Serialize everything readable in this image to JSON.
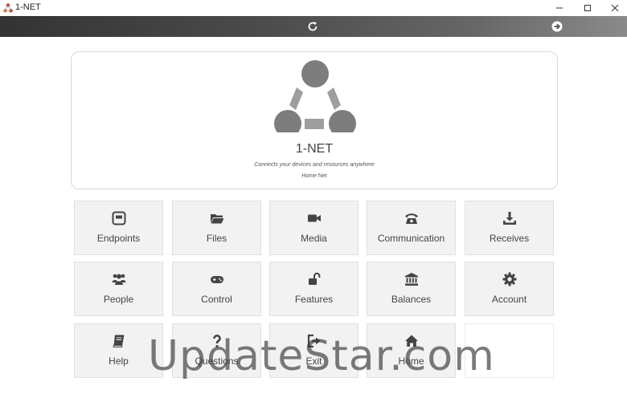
{
  "window": {
    "title": "1-NET",
    "accent": "#c0392b"
  },
  "toolbar": {
    "refresh_icon": "refresh-icon",
    "forward_icon": "forward-arrow-icon"
  },
  "header": {
    "title": "1-NET",
    "tagline": "Connects your devices and resources anywhere",
    "network": "Home Net"
  },
  "tiles": [
    {
      "label": "Endpoints",
      "icon": "endpoint-icon"
    },
    {
      "label": "Files",
      "icon": "folder-icon"
    },
    {
      "label": "Media",
      "icon": "video-camera-icon"
    },
    {
      "label": "Communication",
      "icon": "telephone-icon"
    },
    {
      "label": "Receives",
      "icon": "download-icon"
    },
    {
      "label": "People",
      "icon": "people-icon"
    },
    {
      "label": "Control",
      "icon": "gamepad-icon"
    },
    {
      "label": "Features",
      "icon": "unlock-icon"
    },
    {
      "label": "Balances",
      "icon": "bank-icon"
    },
    {
      "label": "Account",
      "icon": "gear-icon"
    },
    {
      "label": "Help",
      "icon": "book-icon"
    },
    {
      "label": "Questions",
      "icon": "question-icon"
    },
    {
      "label": "Exit",
      "icon": "sign-out-icon"
    },
    {
      "label": "Home",
      "icon": "home-icon"
    }
  ],
  "watermark": "UpdateStar.com"
}
